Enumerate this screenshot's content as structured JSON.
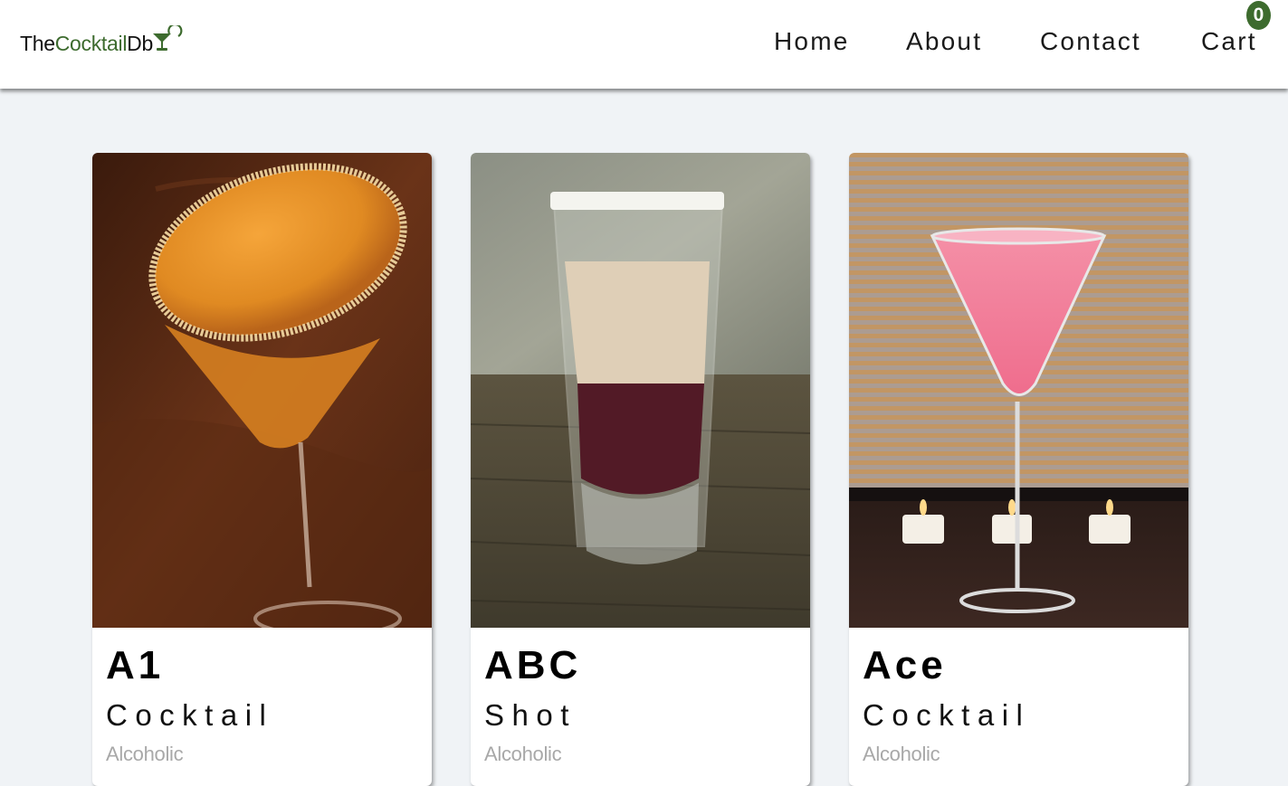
{
  "brand": {
    "prefix": "The",
    "accent": "Cocktail",
    "suffix": "Db",
    "icon": "cocktail-glass-icon",
    "accent_color": "#3d6b2e"
  },
  "nav": {
    "home": "Home",
    "about": "About",
    "contact": "Contact",
    "cart": "Cart",
    "cart_count": "0"
  },
  "drinks": [
    {
      "name": "A1",
      "category": "Cocktail",
      "alcoholic": "Alcoholic",
      "image": "orange-cocktail-sugar-rim-photo"
    },
    {
      "name": "ABC",
      "category": "Shot",
      "alcoholic": "Alcoholic",
      "image": "layered-shot-glass-photo"
    },
    {
      "name": "Ace",
      "category": "Cocktail",
      "alcoholic": "Alcoholic",
      "image": "pink-martini-candles-photo"
    }
  ]
}
